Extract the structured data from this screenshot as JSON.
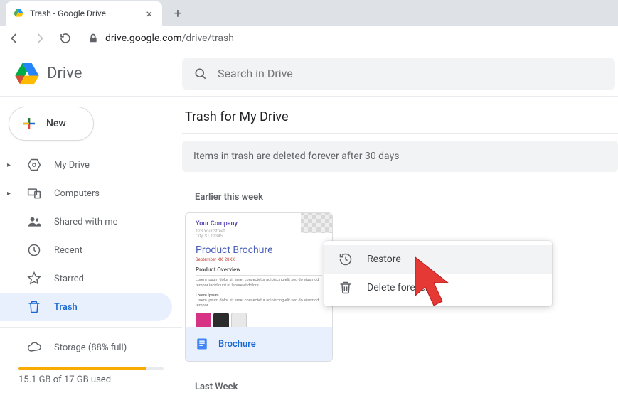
{
  "browser": {
    "tab_title": "Trash - Google Drive",
    "url_host": "drive.google.com",
    "url_path": "/drive/trash"
  },
  "header": {
    "app_name": "Drive",
    "search_placeholder": "Search in Drive"
  },
  "sidebar": {
    "new_label": "New",
    "items": [
      {
        "label": "My Drive",
        "expandable": true
      },
      {
        "label": "Computers",
        "expandable": true
      },
      {
        "label": "Shared with me",
        "expandable": false
      },
      {
        "label": "Recent",
        "expandable": false
      },
      {
        "label": "Starred",
        "expandable": false
      },
      {
        "label": "Trash",
        "expandable": false,
        "active": true
      }
    ],
    "storage_label": "Storage (88% full)",
    "storage_percent": 88,
    "storage_used": "15.1 GB of 17 GB used"
  },
  "content": {
    "title": "Trash for My Drive",
    "banner": "Items in trash are deleted forever after 30 days",
    "sections": [
      {
        "label": "Earlier this week"
      },
      {
        "label": "Last Week"
      }
    ],
    "file": {
      "name": "Brochure",
      "thumb": {
        "company": "Your Company",
        "title": "Product Brochure",
        "overview": "Product Overview",
        "lorem_head": "Lorem Ipsum"
      }
    }
  },
  "context_menu": {
    "restore": "Restore",
    "delete": "Delete forever"
  }
}
